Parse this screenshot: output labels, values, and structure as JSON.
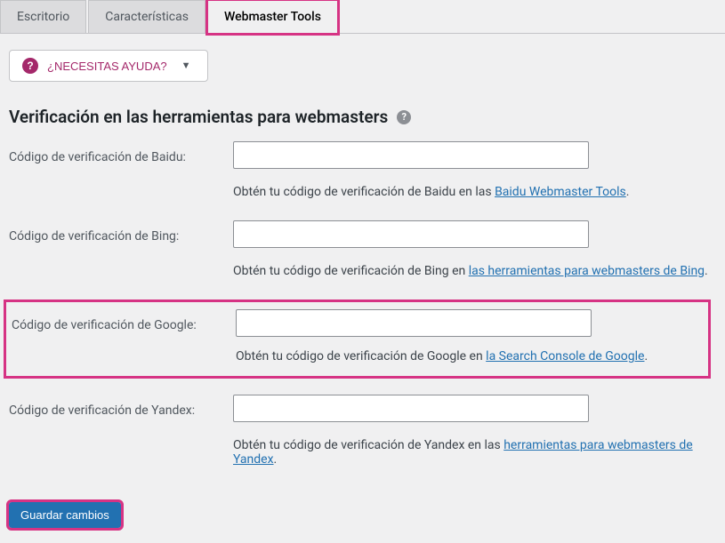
{
  "tabs": [
    {
      "label": "Escritorio"
    },
    {
      "label": "Características"
    },
    {
      "label": "Webmaster Tools"
    }
  ],
  "help": {
    "label": "¿NECESITAS AYUDA?"
  },
  "heading": "Verificación en las herramientas para webmasters",
  "fields": {
    "baidu": {
      "label": "Código de verificación de Baidu:",
      "hint_prefix": "Obtén tu código de verificación de Baidu en las ",
      "hint_link": "Baidu Webmaster Tools",
      "hint_suffix": "."
    },
    "bing": {
      "label": "Código de verificación de Bing:",
      "hint_prefix": "Obtén tu código de verificación de Bing en ",
      "hint_link": "las herramientas para webmasters de Bing",
      "hint_suffix": "."
    },
    "google": {
      "label": "Código de verificación de Google:",
      "hint_prefix": "Obtén tu código de verificación de Google en ",
      "hint_link": "la Search Console de Google",
      "hint_suffix": "."
    },
    "yandex": {
      "label": "Código de verificación de Yandex:",
      "hint_prefix": "Obtén tu código de verificación de Yandex en las ",
      "hint_link": "herramientas para webmasters de Yandex",
      "hint_suffix": "."
    }
  },
  "submit": {
    "label": "Guardar cambios"
  }
}
